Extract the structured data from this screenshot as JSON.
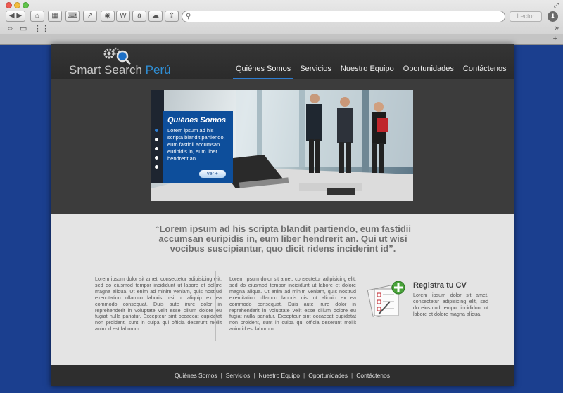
{
  "browser": {
    "reader_label": "Lector"
  },
  "site": {
    "logo": {
      "name": "Smart Search",
      "suffix": "Perú"
    },
    "nav": [
      {
        "label": "Quiénes Somos",
        "active": true
      },
      {
        "label": "Servicios",
        "active": false
      },
      {
        "label": "Nuestro Equipo",
        "active": false
      },
      {
        "label": "Oportunidades",
        "active": false
      },
      {
        "label": "Contáctenos",
        "active": false
      }
    ],
    "slider": {
      "title": "Quiénes Somos",
      "text": "Lorem ipsum ad his scripta blandit partiendo, eum fastidii accumsan euripidis in, eum liber hendrerit an...",
      "button_label": "ver +",
      "active_slide": 1,
      "slide_count": 5
    },
    "quote": "“Lorem ipsum ad his scripta blandit partiendo, eum fastidii accumsan euripidis in, eum liber hendrerit an. Qui ut wisi vocibus suscipiantur, quo dicit ridens inciderint id”.",
    "columns": [
      "Lorem ipsum dolor sit amet, consectetur adipisicing elit, sed do eiusmod tempor incididunt ut labore et dolore magna aliqua. Ut enim ad minim veniam, quis nostrud exercitation ullamco laboris nisi ut aliquip ex ea commodo consequat. Duis aute irure dolor in reprehenderit in voluptate velit esse cillum dolore eu fugiat nulla pariatur. Excepteur sint occaecat cupidatat non proident, sunt in culpa qui officia deserunt mollit anim id est laborum.",
      "Lorem ipsum dolor sit amet, consectetur adipisicing elit, sed do eiusmod tempor incididunt ut labore et dolore magna aliqua. Ut enim ad minim veniam, quis nostrud exercitation ullamco laboris nisi ut aliquip ex ea commodo consequat. Duis aute irure dolor in reprehenderit in voluptate velit esse cillum dolore eu fugiat nulla pariatur. Excepteur sint occaecat cupidatat non proident, sunt in culpa qui officia deserunt mollit anim id est laborum."
    ],
    "cv": {
      "title": "Registra tu CV",
      "text": "Lorem ipsum dolor sit amet, consectetur adipisicing elit, sed do eiusmod tempor incididunt ut labore et dolore magna aliqua."
    },
    "footer_nav": [
      "Quiénes Somos",
      "Servicios",
      "Nuestro Equipo",
      "Oportunidades",
      "Contáctenos"
    ]
  },
  "colors": {
    "accent": "#2e7dd1",
    "caption_bg": "#0d4e9b",
    "page_bg": "#1b3f8f"
  }
}
